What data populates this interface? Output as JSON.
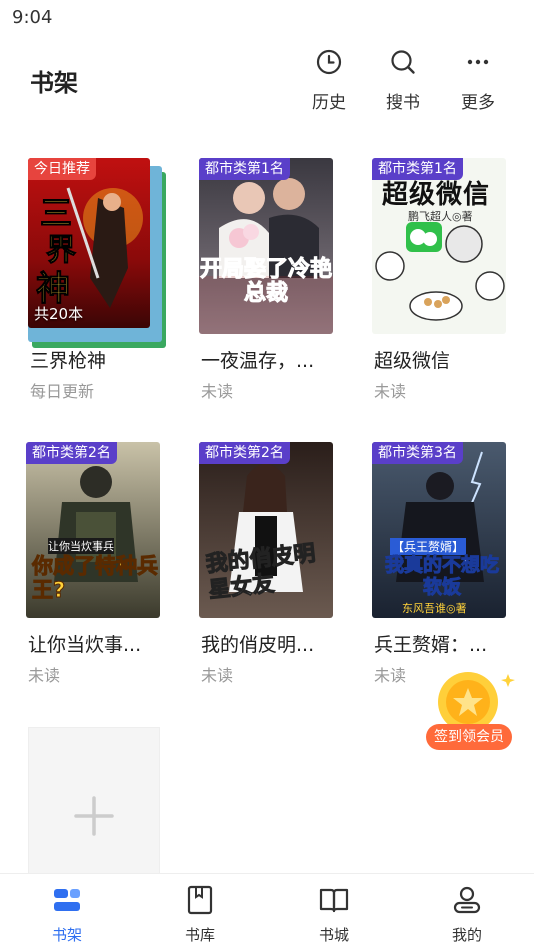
{
  "status_bar": {
    "time": "9:04"
  },
  "header": {
    "title": "书架",
    "actions": [
      {
        "label": "历史",
        "icon": "clock-icon"
      },
      {
        "label": "搜书",
        "icon": "search-icon"
      },
      {
        "label": "更多",
        "icon": "more-dots-icon"
      }
    ]
  },
  "books": [
    {
      "title": "三界枪神",
      "status": "每日更新",
      "badge": "今日推荐",
      "count": "共20本",
      "cover_title": "三界枪神"
    },
    {
      "title": "一夜温存，...",
      "status": "未读",
      "badge": "都市类第1名",
      "cover_title": "开局娶了冷艳总裁",
      "cover_subtitle": "一夜温存"
    },
    {
      "title": "超级微信",
      "status": "未读",
      "badge": "都市类第1名",
      "cover_title": "超级微信",
      "cover_author": "鹏飞超人◎著"
    },
    {
      "title": "让你当炊事...",
      "status": "未读",
      "badge": "都市类第2名",
      "cover_title": "你成了特种兵王?",
      "cover_subtitle": "让你当炊事兵"
    },
    {
      "title": "我的俏皮明...",
      "status": "未读",
      "badge": "都市类第2名",
      "cover_title": "我的俏皮明星女友"
    },
    {
      "title": "兵王赘婿：...",
      "status": "未读",
      "badge": "都市类第3名",
      "cover_title": "我真的不想吃软饭",
      "cover_subtitle": "【兵王赘婿】",
      "cover_author": "东风吾谁◎著"
    }
  ],
  "signin": {
    "label": "签到领会员"
  },
  "tabs": [
    {
      "label": "书架",
      "icon": "bookshelf-icon",
      "active": true
    },
    {
      "label": "书库",
      "icon": "book-library-icon",
      "active": false
    },
    {
      "label": "书城",
      "icon": "open-book-icon",
      "active": false
    },
    {
      "label": "我的",
      "icon": "profile-icon",
      "active": false
    }
  ],
  "colors": {
    "accent": "#2f6ff0",
    "badge_purple": "#5a3fc9",
    "badge_red": "#e7443e",
    "signin_orange": "#ff6a3a"
  }
}
